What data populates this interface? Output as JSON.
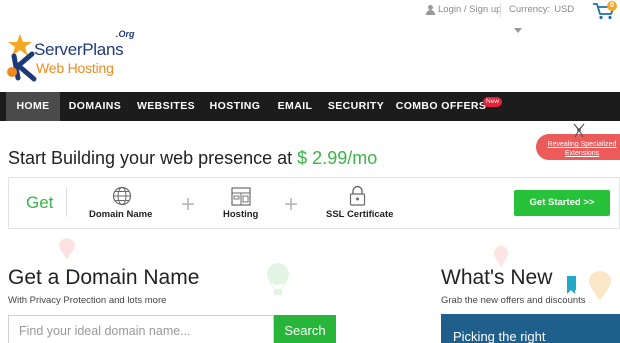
{
  "topbar": {
    "login_label": "Login / Sign up",
    "currency_label": "Currency:",
    "currency_value": "USD",
    "cart_count": "0"
  },
  "logo": {
    "org": ".Org",
    "name": "ServerPlans",
    "sub": "Web Hosting"
  },
  "nav": {
    "items": [
      {
        "label": "HOME"
      },
      {
        "label": "DOMAINS"
      },
      {
        "label": "WEBSITES"
      },
      {
        "label": "HOSTING"
      },
      {
        "label": "EMAIL"
      },
      {
        "label": "SECURITY"
      },
      {
        "label": "COMBO OFFERS"
      }
    ],
    "new_badge": "New"
  },
  "hero": {
    "title_prefix": "Start Building your web presence at ",
    "price": "$ 2.99/mo",
    "promo": "Revealing Specialized Extensions"
  },
  "strip": {
    "get_label": "Get",
    "items": [
      {
        "label": "Domain Name",
        "icon": "globe-icon"
      },
      {
        "label": "Hosting",
        "icon": "server-icon"
      },
      {
        "label": "SSL Certificate",
        "icon": "lock-icon"
      }
    ],
    "cta": "Get Started >>"
  },
  "domain": {
    "title": "Get a Domain Name",
    "subtitle": "With Privacy Protection and lots more",
    "placeholder": "Find your ideal domain name...",
    "search_button": "Search"
  },
  "whats_new": {
    "title": "What's New",
    "subtitle": "Grab the new offers and discounts",
    "card_text": "Picking the right"
  },
  "colors": {
    "accent_green": "#27b53a",
    "nav_bg": "#1c1c1c",
    "brand_blue": "#1f3a78",
    "brand_orange": "#f08a1c"
  }
}
